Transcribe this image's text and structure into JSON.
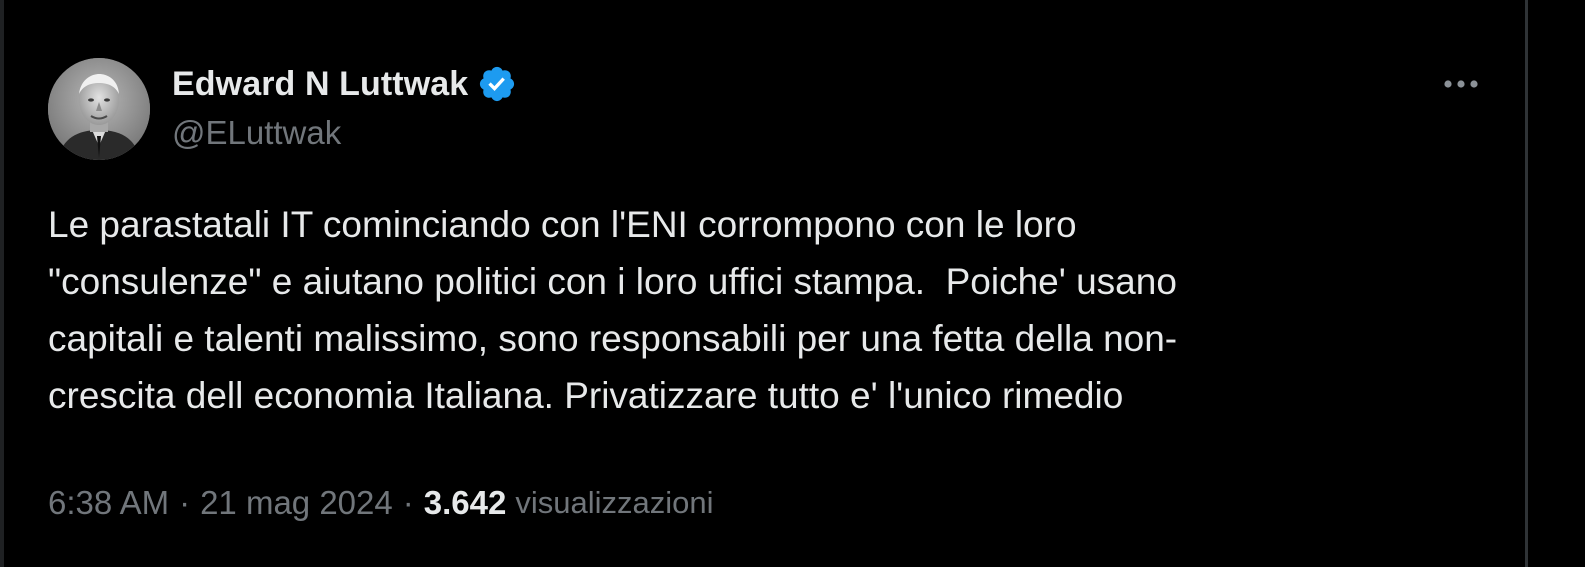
{
  "author": {
    "display_name": "Edward N Luttwak",
    "handle": "@ELuttwak",
    "verified": true,
    "verified_color": "#1d9bf0"
  },
  "tweet": {
    "text_lines": [
      "Le parastatali IT cominciando con l'ENI corrompono con le loro",
      "\"consulenze\" e aiutano politici con i loro uffici stampa.  Poiche' usano",
      "capitali e talenti malissimo, sono responsabili per una fetta della non-",
      "crescita dell economia Italiana. Privatizzare tutto e' l'unico rimedio"
    ]
  },
  "meta": {
    "time": "6:38 AM",
    "separator": "·",
    "date": "21 mag 2024",
    "views_count": "3.642",
    "views_label": "visualizzazioni"
  },
  "icons": {
    "verified": "verified-badge-icon",
    "more": "more-horizontal-icon"
  },
  "colors": {
    "background": "#000000",
    "text_primary": "#e7e9ea",
    "text_secondary": "#71767b",
    "divider": "#2f3336"
  }
}
